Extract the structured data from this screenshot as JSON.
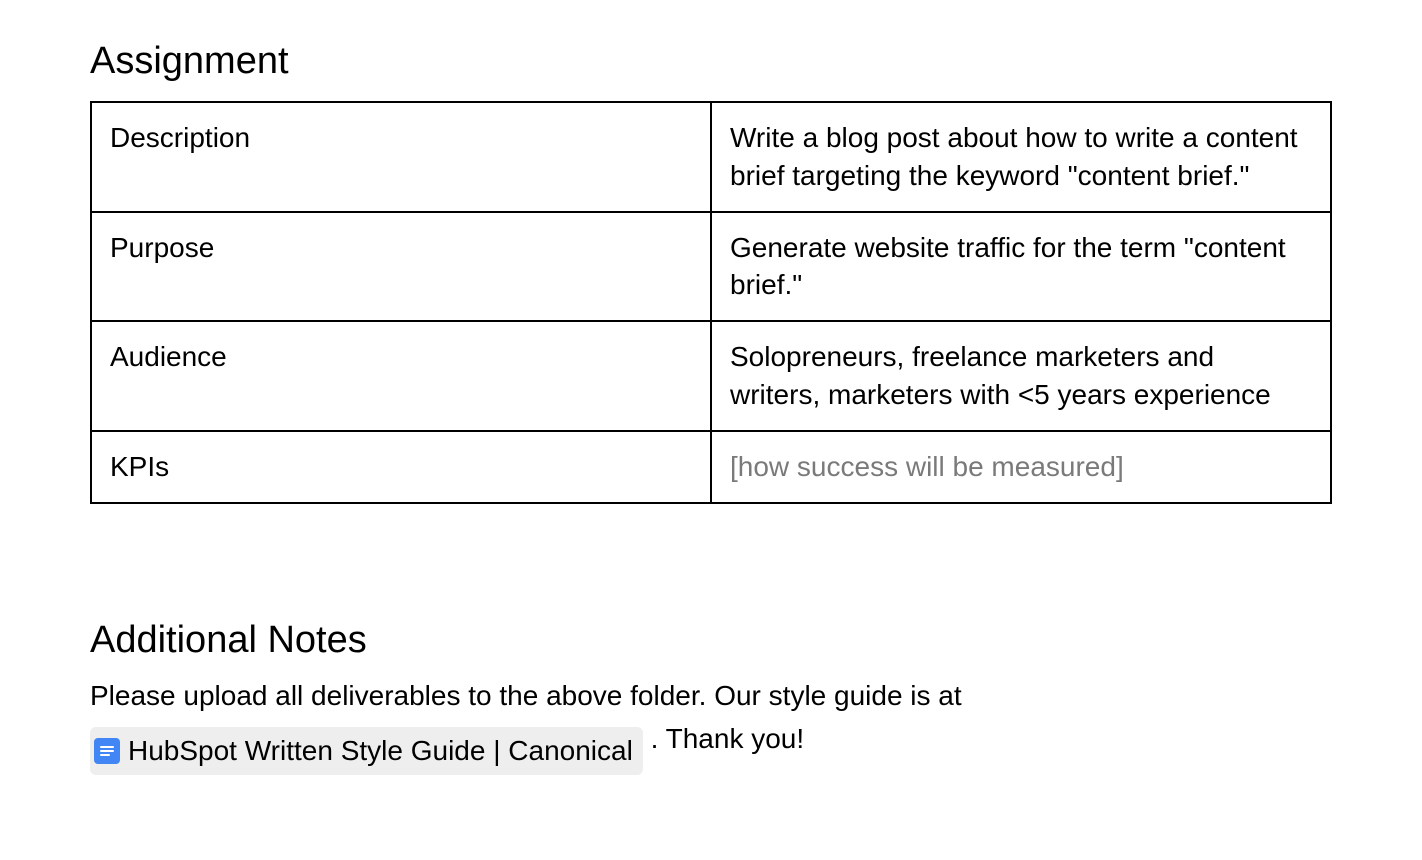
{
  "assignment": {
    "heading": "Assignment",
    "rows": [
      {
        "label": "Description",
        "value": "Write a blog post about how to write a content brief targeting the keyword \"content brief.\"",
        "placeholder": false
      },
      {
        "label": "Purpose",
        "value": "Generate website traffic for the term \"content brief.\"",
        "placeholder": false
      },
      {
        "label": "Audience",
        "value": "Solopreneurs, freelance marketers and writers, marketers with <5 years experience",
        "placeholder": false
      },
      {
        "label": "KPIs",
        "value": "[how success will be measured]",
        "placeholder": true
      }
    ]
  },
  "notes": {
    "heading": "Additional Notes",
    "intro": "Please upload all deliverables to the above folder. Our style guide is at ",
    "doc_chip_label": "HubSpot Written Style Guide | Canonical",
    "outro": " . Thank you!"
  }
}
